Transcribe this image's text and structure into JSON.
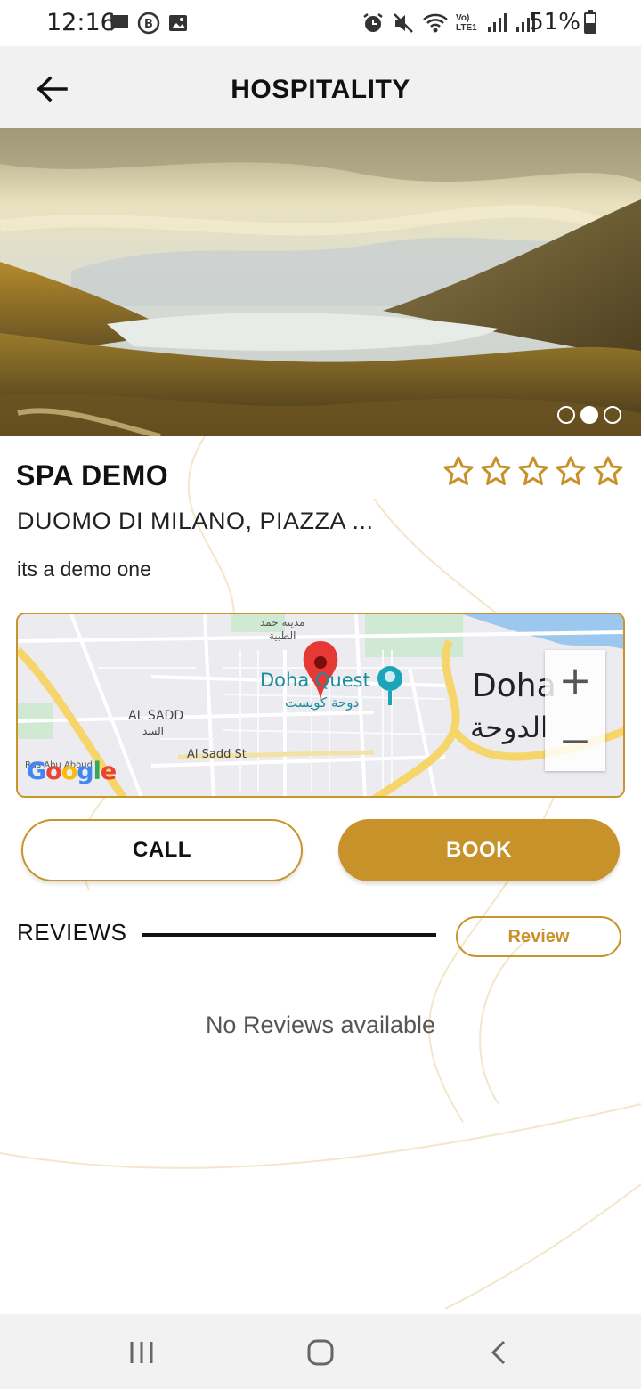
{
  "status_bar": {
    "time": "12:16",
    "battery_percent": "51%",
    "battery_level": 0.51,
    "network_label": "Vo) LTE1",
    "left_icons": [
      "message-icon",
      "b-app-icon",
      "gallery-icon"
    ],
    "right_icons": [
      "alarm-icon",
      "mute-icon",
      "wifi-icon",
      "signal-icon",
      "signal-icon",
      "battery-icon"
    ]
  },
  "header": {
    "title": "HOSPITALITY",
    "back_icon": "arrow-left-icon"
  },
  "carousel": {
    "image_description_icon": "landscape-photo",
    "slide_count": 3,
    "active_index": 1
  },
  "place": {
    "name": "SPA DEMO",
    "rating": 0,
    "max_rating": 5,
    "address": "DUOMO DI MILANO, PIAZZA ...",
    "description": "its  a demo one"
  },
  "map": {
    "labels": {
      "hamad": "مدينة حمد",
      "hamad2": "الطبية",
      "doha_quest": "Doha Quest",
      "doha_quest_ar": "دوحة كويست",
      "al_sadd": "AL SADD",
      "al_sadd_ar": "السد",
      "al_sadd_st": "Al Sadd St",
      "doha": "Doha",
      "doha_ar": "الدوحة",
      "street_small": "Ras Abu Aboud St"
    },
    "zoom_in": "+",
    "zoom_out": "−",
    "attribution": "Google"
  },
  "actions": {
    "call": "CALL",
    "book": "BOOK"
  },
  "reviews": {
    "title": "REVIEWS",
    "review_button": "Review",
    "empty_text": "No Reviews available"
  },
  "colors": {
    "accent": "#c8922a",
    "header_bg": "#f1f1f1",
    "nav_bg": "#f2f2f2"
  },
  "nav": {
    "icons": [
      "recent-apps-icon",
      "home-icon",
      "back-icon"
    ]
  }
}
